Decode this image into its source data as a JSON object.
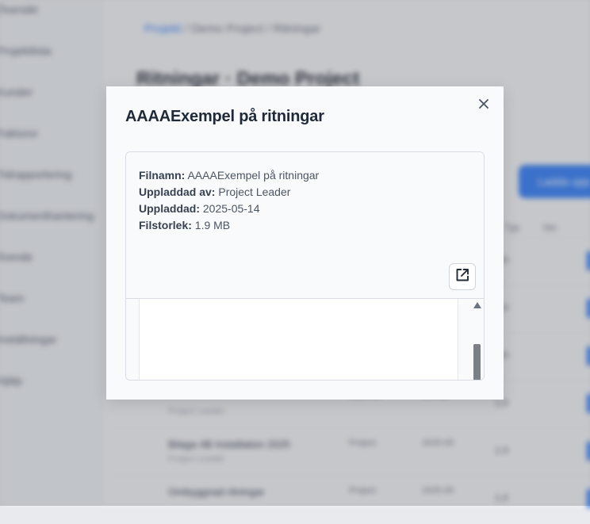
{
  "modal": {
    "title": "AAAAExempel på ritningar",
    "close_icon": "close-icon",
    "open_external_icon": "external-link-icon",
    "meta": {
      "filename_label": "Filnamn:",
      "filename_value": "AAAAExempel på ritningar",
      "uploaded_by_label": "Uppladdad av:",
      "uploaded_by_value": "Project Leader",
      "uploaded_label": "Uppladdad:",
      "uploaded_value": "2025-05-14",
      "filesize_label": "Filstorlek:",
      "filesize_value": "1.9 MB"
    }
  },
  "colors": {
    "accent": "#3b82f6",
    "modal_bg": "#f9fafb",
    "text_dark": "#1f2937"
  }
}
